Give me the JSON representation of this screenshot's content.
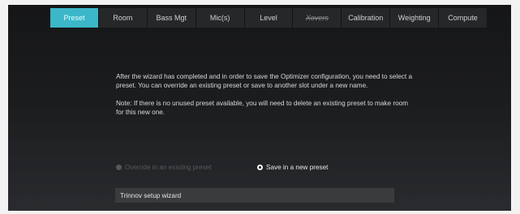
{
  "tabs": [
    {
      "label": "Preset",
      "state": "active"
    },
    {
      "label": "Room",
      "state": "normal"
    },
    {
      "label": "Bass Mgt",
      "state": "normal"
    },
    {
      "label": "Mic(s)",
      "state": "normal"
    },
    {
      "label": "Level",
      "state": "normal"
    },
    {
      "label": "Xovers",
      "state": "disabled"
    },
    {
      "label": "Calibration",
      "state": "normal"
    },
    {
      "label": "Weighting",
      "state": "normal"
    },
    {
      "label": "Compute",
      "state": "normal"
    }
  ],
  "content": {
    "paragraph1": "After the wizard has completed and in order to save the Optimizer configuration, you need to select a preset. You can override an existing preset or save to another slot under a new name.",
    "paragraph2": "Note: If there is no unused preset available, you will need to delete an existing preset to make room for this new one."
  },
  "options": {
    "override_label": "Override in an existing preset",
    "save_new_label": "Save in a new preset",
    "selected": "Save in a new preset"
  },
  "preset_name": {
    "value": "Trinnov setup wizard"
  },
  "colors": {
    "accent": "#3bb7c9",
    "background": "#1b1c1e",
    "tab_bar": "#262728"
  }
}
